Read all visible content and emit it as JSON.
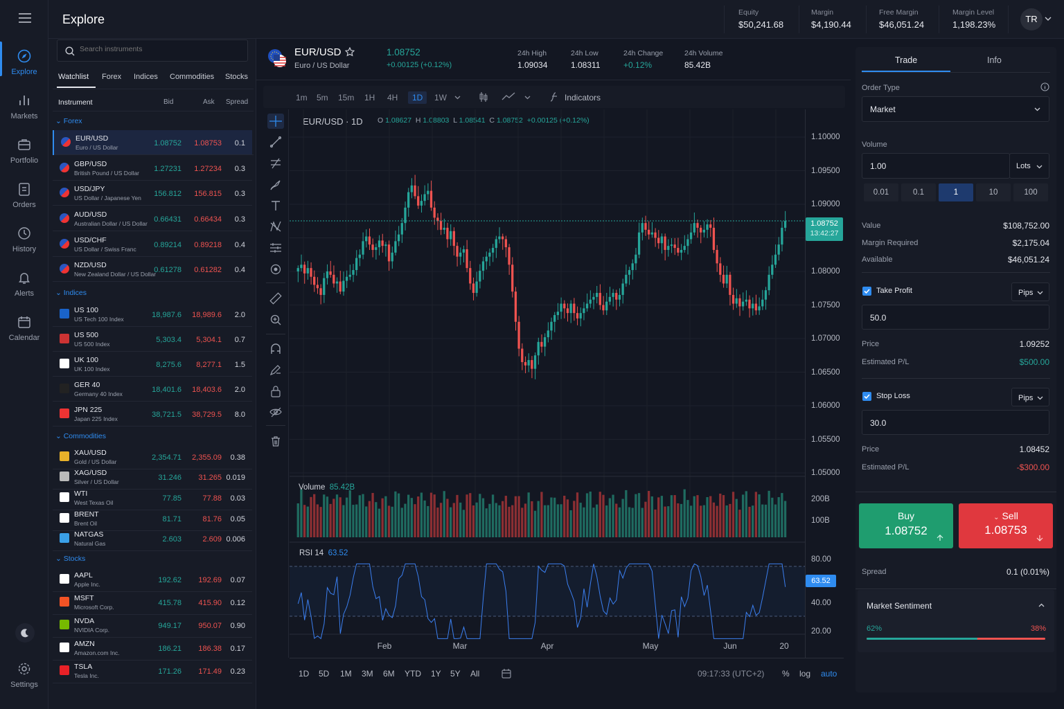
{
  "app": {
    "title": "Explore"
  },
  "account": {
    "equity_label": "Equity",
    "equity": "$50,241.68",
    "margin_label": "Margin",
    "margin": "$4,190.44",
    "free_margin_label": "Free Margin",
    "free_margin": "$46,051.24",
    "margin_level_label": "Margin Level",
    "margin_level": "1,198.23%",
    "avatar": "TR"
  },
  "nav": [
    {
      "label": "Explore",
      "icon": "compass-icon"
    },
    {
      "label": "Markets",
      "icon": "bar-chart-icon"
    },
    {
      "label": "Portfolio",
      "icon": "briefcase-icon"
    },
    {
      "label": "Orders",
      "icon": "clipboard-icon"
    },
    {
      "label": "History",
      "icon": "history-icon"
    },
    {
      "label": "Alerts",
      "icon": "bell-icon"
    },
    {
      "label": "Calendar",
      "icon": "calendar-icon"
    },
    {
      "label": "Settings",
      "icon": "gear-icon"
    }
  ],
  "search": {
    "placeholder": "Search instruments"
  },
  "watch_tabs": [
    "Watchlist",
    "Forex",
    "Indices",
    "Commodities",
    "Stocks"
  ],
  "watch_headers": {
    "instrument": "Instrument",
    "bid": "Bid",
    "ask": "Ask",
    "spread": "Spread"
  },
  "sections": {
    "forex": "Forex",
    "indices": "Indices",
    "commodities": "Commodities",
    "stocks": "Stocks"
  },
  "forex": [
    {
      "sym": "EUR/USD",
      "name": "Euro / US Dollar",
      "bid": "1.08752",
      "ask": "1.08753",
      "spread": "0.1"
    },
    {
      "sym": "GBP/USD",
      "name": "British Pound / US Dollar",
      "bid": "1.27231",
      "ask": "1.27234",
      "spread": "0.3"
    },
    {
      "sym": "USD/JPY",
      "name": "US Dollar / Japanese Yen",
      "bid": "156.812",
      "ask": "156.815",
      "spread": "0.3"
    },
    {
      "sym": "AUD/USD",
      "name": "Australian Dollar / US Dollar",
      "bid": "0.66431",
      "ask": "0.66434",
      "spread": "0.3"
    },
    {
      "sym": "USD/CHF",
      "name": "US Dollar / Swiss Franc",
      "bid": "0.89214",
      "ask": "0.89218",
      "spread": "0.4"
    },
    {
      "sym": "NZD/USD",
      "name": "New Zealand Dollar / US Dollar",
      "bid": "0.61278",
      "ask": "0.61282",
      "spread": "0.4"
    }
  ],
  "indices": [
    {
      "sym": "US 100",
      "name": "US Tech 100 Index",
      "bid": "18,987.6",
      "ask": "18,989.6",
      "spread": "2.0",
      "badge": "100"
    },
    {
      "sym": "US 500",
      "name": "US 500 Index",
      "bid": "5,303.4",
      "ask": "5,304.1",
      "spread": "0.7"
    },
    {
      "sym": "UK 100",
      "name": "UK 100 Index",
      "bid": "8,275.6",
      "ask": "8,277.1",
      "spread": "1.5"
    },
    {
      "sym": "GER 40",
      "name": "Germany 40 Index",
      "bid": "18,401.6",
      "ask": "18,403.6",
      "spread": "2.0"
    },
    {
      "sym": "JPN 225",
      "name": "Japan 225 Index",
      "bid": "38,721.5",
      "ask": "38,729.5",
      "spread": "8.0"
    }
  ],
  "commodities": [
    {
      "sym": "XAU/USD",
      "name": "Gold / US Dollar",
      "bid": "2,354.71",
      "ask": "2,355.09",
      "spread": "0.38"
    },
    {
      "sym": "XAG/USD",
      "name": "Silver / US Dollar",
      "bid": "31.246",
      "ask": "31.265",
      "spread": "0.019"
    },
    {
      "sym": "WTI",
      "name": "West Texas Oil",
      "bid": "77.85",
      "ask": "77.88",
      "spread": "0.03"
    },
    {
      "sym": "BRENT",
      "name": "Brent Oil",
      "bid": "81.71",
      "ask": "81.76",
      "spread": "0.05"
    },
    {
      "sym": "NATGAS",
      "name": "Natural Gas",
      "bid": "2.603",
      "ask": "2.609",
      "spread": "0.006"
    }
  ],
  "stocks": [
    {
      "sym": "AAPL",
      "name": "Apple Inc.",
      "bid": "192.62",
      "ask": "192.69",
      "spread": "0.07"
    },
    {
      "sym": "MSFT",
      "name": "Microsoft Corp.",
      "bid": "415.78",
      "ask": "415.90",
      "spread": "0.12"
    },
    {
      "sym": "NVDA",
      "name": "NVIDIA Corp.",
      "bid": "949.17",
      "ask": "950.07",
      "spread": "0.90"
    },
    {
      "sym": "AMZN",
      "name": "Amazon.com Inc.",
      "bid": "186.21",
      "ask": "186.38",
      "spread": "0.17"
    },
    {
      "sym": "TSLA",
      "name": "Tesla Inc.",
      "bid": "171.26",
      "ask": "171.49",
      "spread": "0.23"
    }
  ],
  "instrument": {
    "symbol": "EUR/USD",
    "name": "Euro / US Dollar",
    "price": "1.08752",
    "change": "+0.00125 (+0.12%)",
    "high_label": "24h High",
    "high": "1.09034",
    "low_label": "24h Low",
    "low": "1.08311",
    "chg_label": "24h Change",
    "chg": "+0.12%",
    "vol_label": "24h Volume",
    "vol": "85.42B"
  },
  "timeframes": [
    "1m",
    "5m",
    "15m",
    "1H",
    "4H",
    "1D",
    "1W"
  ],
  "active_timeframe": "1D",
  "indicators_label": "Indicators",
  "legend": {
    "title": "EUR/USD · 1D",
    "o_label": "O",
    "o": "1.08627",
    "h_label": "H",
    "h": "1.08803",
    "l_label": "L",
    "l": "1.08541",
    "c_label": "C",
    "c": "1.08752",
    "chg": "+0.00125 (+0.12%)"
  },
  "price_tag": {
    "price": "1.08752",
    "countdown": "13:42:27"
  },
  "volume_label": "Volume",
  "volume_value": "85.42B",
  "rsi_label": "RSI 14",
  "rsi_value": "63.52",
  "ranges": [
    "1D",
    "5D",
    "1M",
    "3M",
    "6M",
    "YTD",
    "1Y",
    "5Y",
    "All"
  ],
  "footer": {
    "time": "09:17:33 (UTC+2)",
    "pct": "%",
    "log": "log",
    "auto": "auto"
  },
  "chart_data": [
    {
      "type": "candlestick",
      "title": "EUR/USD · 1D",
      "x_ticks": [
        "Feb",
        "Mar",
        "Apr",
        "May",
        "Jun",
        "20"
      ],
      "y_ticks": [
        "1.10000",
        "1.09500",
        "1.09000",
        "1.08500",
        "1.08000",
        "1.07500",
        "1.07000",
        "1.06500",
        "1.06000",
        "1.05500",
        "1.05000"
      ],
      "ylim": [
        1.05,
        1.1
      ],
      "last": 1.08752,
      "close": [
        1.0805,
        1.081,
        1.0797,
        1.0805,
        1.0792,
        1.078,
        1.0775,
        1.0765,
        1.079,
        1.08,
        1.0795,
        1.0782,
        1.0785,
        1.077,
        1.0786,
        1.0792,
        1.0795,
        1.0802,
        1.082,
        1.0825,
        1.0845,
        1.0852,
        1.084,
        1.0832,
        1.0836,
        1.0846,
        1.0838,
        1.084,
        1.0815,
        1.0828,
        1.0845,
        1.0855,
        1.0872,
        1.0895,
        1.0918,
        1.0928,
        1.0912,
        1.0898,
        1.0905,
        1.0915,
        1.092,
        1.0895,
        1.088,
        1.0875,
        1.0862,
        1.0865,
        1.0848,
        1.086,
        1.0838,
        1.0822,
        1.0828,
        1.0833,
        1.0805,
        1.0782,
        1.0768,
        1.0785,
        1.0801,
        1.0815,
        1.0822,
        1.0828,
        1.0835,
        1.0848,
        1.0852,
        1.0848,
        1.0836,
        1.081,
        1.077,
        1.0725,
        1.0685,
        1.0665,
        1.066,
        1.0668,
        1.0655,
        1.0675,
        1.0695,
        1.0688,
        1.0702,
        1.0712,
        1.0725,
        1.0735,
        1.074,
        1.0752,
        1.0745,
        1.0738,
        1.0752,
        1.0738,
        1.073,
        1.0738,
        1.0745,
        1.0752,
        1.0758,
        1.0762,
        1.0768,
        1.075,
        1.0742,
        1.0755,
        1.0762,
        1.0768,
        1.0758,
        1.0765,
        1.0782,
        1.0795,
        1.0802,
        1.0812,
        1.0825,
        1.0858,
        1.0872,
        1.0862,
        1.0855,
        1.0858,
        1.085,
        1.0842,
        1.0852,
        1.0832,
        1.0838,
        1.084,
        1.0835,
        1.0828,
        1.0832,
        1.0838,
        1.0848,
        1.0858,
        1.0872,
        1.0865,
        1.0858,
        1.0862,
        1.087,
        1.0865,
        1.0832,
        1.0812,
        1.0795,
        1.0782,
        1.0795,
        1.0765,
        1.0752,
        1.076,
        1.0748,
        1.0755,
        1.0758,
        1.0745,
        1.0752,
        1.0742,
        1.0748,
        1.0758,
        1.0772,
        1.0795,
        1.081,
        1.0825,
        1.084,
        1.0865,
        1.0875
      ]
    },
    {
      "type": "bar",
      "title": "Volume",
      "y_ticks": [
        "200B",
        "100B"
      ]
    },
    {
      "type": "line",
      "title": "RSI 14",
      "y_ticks": [
        "80.00",
        "40.00",
        "20.00"
      ],
      "last": 63.52
    }
  ],
  "trade": {
    "tabs": [
      "Trade",
      "Info"
    ],
    "order_type_label": "Order Type",
    "order_type": "Market",
    "volume_label": "Volume",
    "volume": "1.00",
    "unit": "Lots",
    "presets": [
      "0.01",
      "0.1",
      "1",
      "10",
      "100"
    ],
    "value_label": "Value",
    "value": "$108,752.00",
    "margin_req_label": "Margin Required",
    "margin_req": "$2,175.04",
    "available_label": "Available",
    "available": "$46,051.24",
    "tp_label": "Take Profit",
    "tp_unit": "Pips",
    "tp": "50.0",
    "tp_price_label": "Price",
    "tp_price": "1.09252",
    "tp_pl_label": "Estimated P/L",
    "tp_pl": "$500.00",
    "sl_label": "Stop Loss",
    "sl_unit": "Pips",
    "sl": "30.0",
    "sl_price_label": "Price",
    "sl_price": "1.08452",
    "sl_pl_label": "Estimated P/L",
    "sl_pl": "-$300.00",
    "buy_label": "Buy",
    "buy_price": "1.08752",
    "sell_label": "Sell",
    "sell_price": "1.08753",
    "spread_label": "Spread",
    "spread": "0.1 (0.01%)",
    "sentiment_label": "Market Sentiment",
    "buy_pct": "62%",
    "sell_pct": "38%",
    "buy_share": 0.62
  },
  "colors": {
    "up": "#26a69a",
    "down": "#ef5350",
    "accent": "#2f8cf0"
  }
}
